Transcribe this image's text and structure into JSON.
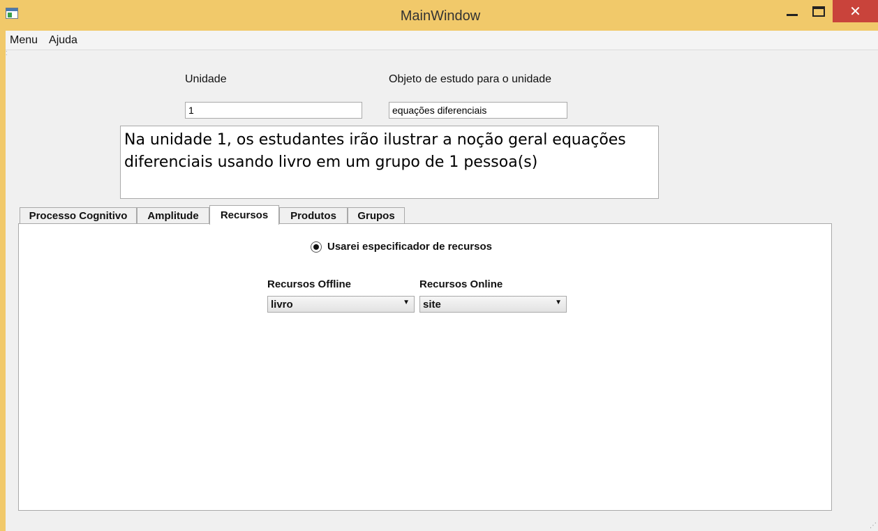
{
  "window": {
    "title": "MainWindow",
    "minimize_glyph": "",
    "close_glyph": "✕"
  },
  "menubar": {
    "items": [
      "Menu",
      "Ajuda"
    ]
  },
  "form": {
    "unidade_label": "Unidade",
    "unidade_value": "1",
    "objeto_label": "Objeto de estudo para o unidade",
    "objeto_value": "equações diferenciais",
    "sentence": "Na unidade 1, os estudantes irão ilustrar a noção geral equações diferenciais  usando livro em um grupo de 1 pessoa(s)"
  },
  "tabs": [
    {
      "label": "Processo Cognitivo",
      "active": false
    },
    {
      "label": "Amplitude",
      "active": false
    },
    {
      "label": "Recursos",
      "active": true
    },
    {
      "label": "Produtos",
      "active": false
    },
    {
      "label": "Grupos",
      "active": false
    }
  ],
  "recursos": {
    "radio_label": "Usarei especificador de recursos",
    "radio_checked": true,
    "offline_label": "Recursos Offline",
    "offline_value": "livro",
    "online_label": "Recursos Online",
    "online_value": "site"
  },
  "icons": {
    "app": "app-window-icon",
    "dropdown": "▼",
    "grip": "⁚",
    "resize": "⋰"
  },
  "colors": {
    "titlebar": "#f1c96a",
    "close_button": "#c9433b",
    "client_background": "#f0f0f0"
  }
}
